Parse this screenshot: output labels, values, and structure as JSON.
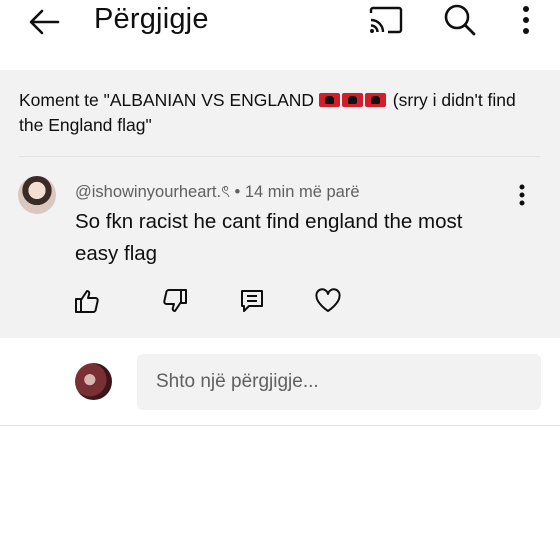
{
  "header": {
    "title": "Përgjigje",
    "icons": [
      "back-arrow-icon",
      "cast-icon",
      "search-icon",
      "more-vertical-icon"
    ]
  },
  "context": {
    "prefix": "Koment te \"ALBANIAN VS ENGLAND ",
    "suffix": " (srry i didn't find the England flag\"",
    "flag_count": 3,
    "flag_icon": "albania-flag-icon"
  },
  "comment": {
    "author": "@ishowinyourheart.ৎ",
    "separator": "•",
    "time": "14 min më parë",
    "text": "So fkn racist he cant find england the most easy flag",
    "actions": [
      "like-icon",
      "dislike-icon",
      "reply-icon",
      "heart-icon"
    ]
  },
  "reply_box": {
    "placeholder": "Shto një përgjigje..."
  },
  "colors": {
    "panel_bg": "#f2f2f2",
    "text_primary": "#0f0f0f",
    "text_secondary": "#606060",
    "input_bg": "#f2f2f2"
  }
}
